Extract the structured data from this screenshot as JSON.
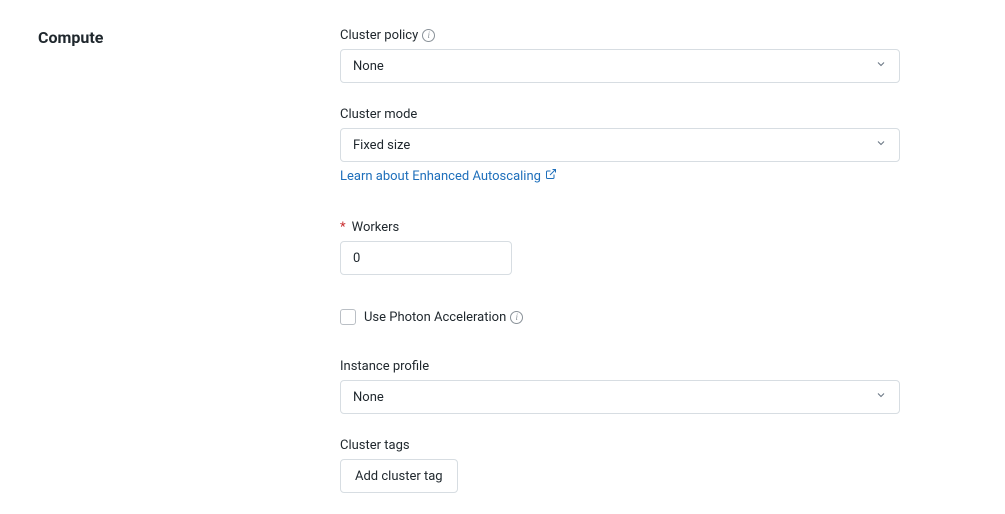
{
  "section": {
    "title": "Compute"
  },
  "clusterPolicy": {
    "label": "Cluster policy",
    "value": "None"
  },
  "clusterMode": {
    "label": "Cluster mode",
    "value": "Fixed size",
    "helpLink": "Learn about Enhanced Autoscaling"
  },
  "workers": {
    "label": "Workers",
    "value": "0"
  },
  "photon": {
    "label": "Use Photon Acceleration"
  },
  "instanceProfile": {
    "label": "Instance profile",
    "value": "None"
  },
  "clusterTags": {
    "label": "Cluster tags",
    "buttonLabel": "Add cluster tag"
  }
}
